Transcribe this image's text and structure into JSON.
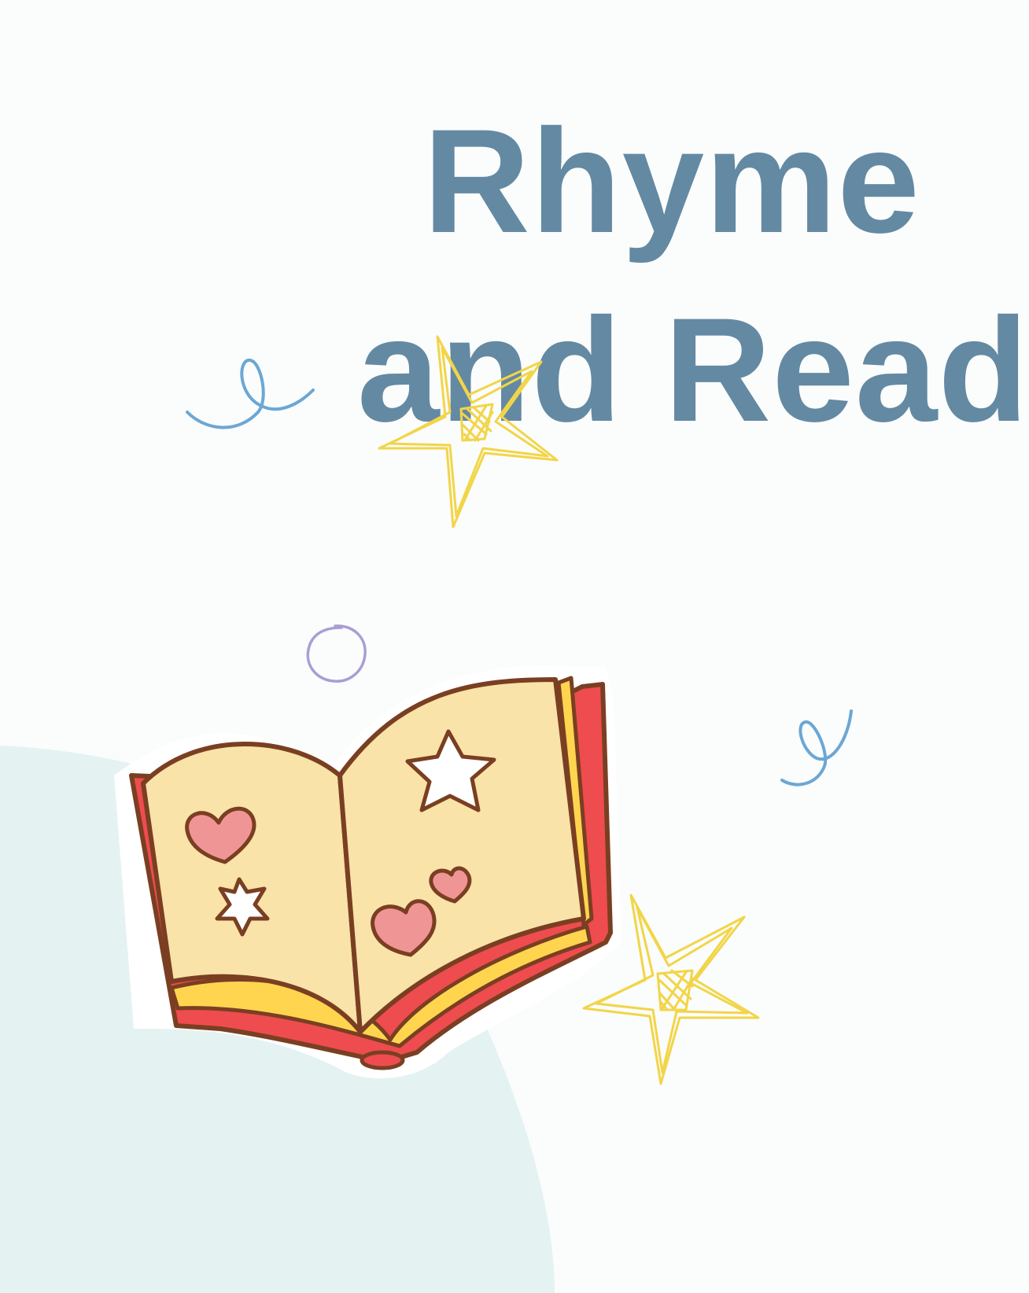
{
  "title": {
    "line1": "Rhyme",
    "line2": "and Read",
    "color": "#6489a3"
  },
  "colors": {
    "background": "#fbfcfc",
    "blob": "#e4f2f2",
    "squiggle": "#6ba7d4",
    "circle": "#a99ed4",
    "star_outline": "#f2d548",
    "book_outline": "#7a3f22",
    "book_cover": "#ef4c4f",
    "book_page": "#f9e3a8",
    "book_page_edge": "#ffd54f",
    "heart": "#f09595"
  },
  "decorations": [
    "squiggle-icon",
    "circle-icon",
    "star-doodle-icon",
    "open-book-icon",
    "heart-icon",
    "star-icon"
  ]
}
